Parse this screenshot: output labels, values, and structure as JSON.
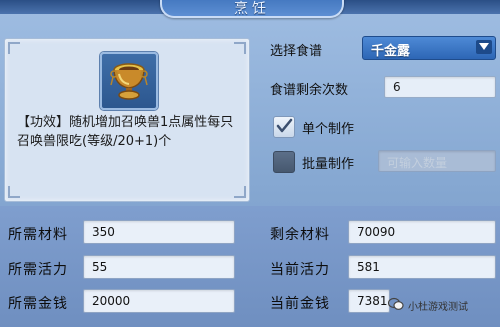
{
  "window": {
    "title": "烹饪"
  },
  "item": {
    "icon": "golden-cauldron-icon",
    "description": "【功效】随机增加召唤兽1点属性每只召唤兽限吃(等级/20+1)个"
  },
  "controls": {
    "recipe_label": "选择食谱",
    "recipe_selected": "千金露",
    "remaining_label": "食谱剩余次数",
    "remaining_value": "6",
    "single_label": "单个制作",
    "single_checked": true,
    "batch_label": "批量制作",
    "batch_checked": false,
    "batch_placeholder": "可输入数量"
  },
  "stats": {
    "required_material_label": "所需材料",
    "required_material_value": "350",
    "required_vitality_label": "所需活力",
    "required_vitality_value": "55",
    "required_money_label": "所需金钱",
    "required_money_value": "20000",
    "remaining_material_label": "剩余材料",
    "remaining_material_value": "70090",
    "current_vitality_label": "当前活力",
    "current_vitality_value": "581",
    "current_money_label": "当前金钱",
    "current_money_value": "7381"
  },
  "watermark": {
    "text": "小杜游戏测试"
  },
  "colors": {
    "accent": "#2d66b5",
    "panel": "#d7e3f2",
    "background": "#86a8d2"
  }
}
